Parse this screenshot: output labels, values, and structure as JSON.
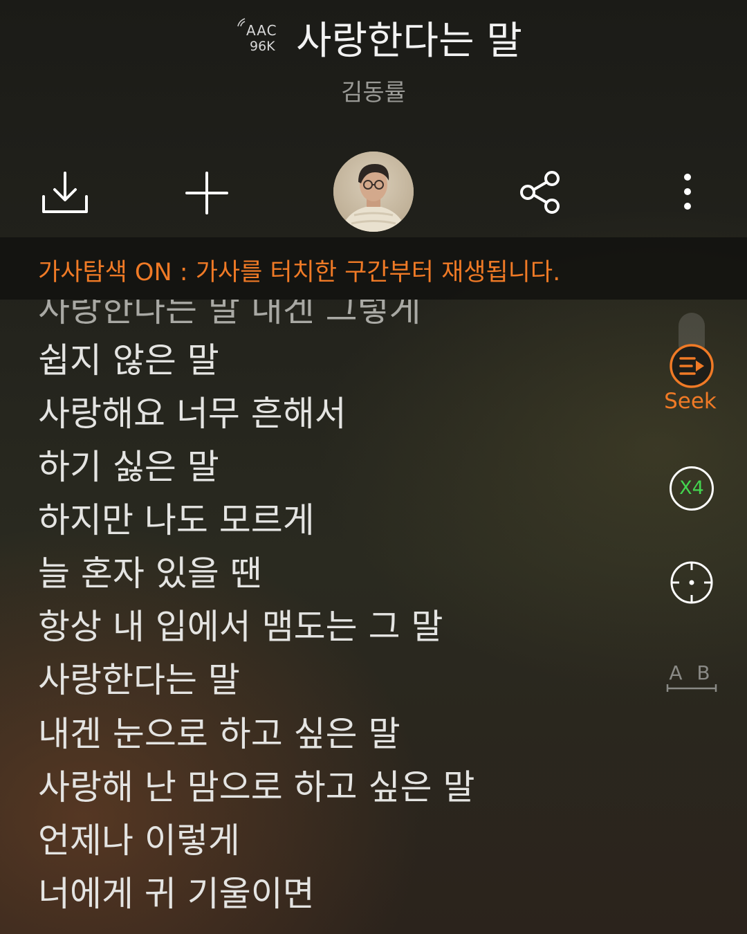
{
  "header": {
    "quality_codec": "AAC",
    "quality_rate": "96K",
    "song_title": "사랑한다는 말",
    "artist": "김동률"
  },
  "actions": {
    "download_icon": "download-icon",
    "add_icon": "plus-icon",
    "share_icon": "share-icon",
    "more_icon": "more-vertical-icon"
  },
  "notice": {
    "text": "가사탐색 ON : 가사를 터치한 구간부터 재생됩니다."
  },
  "lyrics": [
    "사랑한다는 말 내겐 그렇게",
    "쉽지 않은 말",
    "사랑해요 너무 흔해서",
    "하기 싫은 말",
    "하지만 나도 모르게",
    "늘 혼자 있을 땐",
    "항상 내 입에서 맴도는 그 말",
    "사랑한다는 말",
    "내겐 눈으로 하고 싶은 말",
    "사랑해 난 맘으로 하고 싶은 말",
    "언제나 이렇게",
    "너에게 귀 기울이면"
  ],
  "controls": {
    "seek_label": "Seek",
    "speed_label": "X4",
    "ab_label": "A B",
    "colors": {
      "accent_orange": "#f07a26",
      "speed_green": "#43d64f"
    }
  }
}
